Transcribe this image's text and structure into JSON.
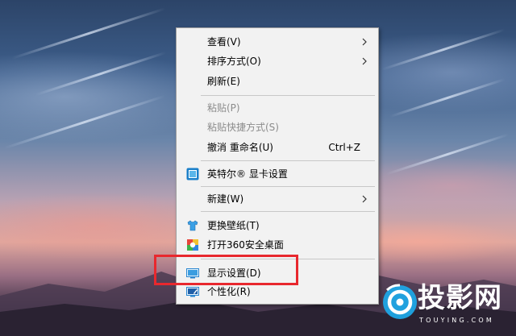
{
  "context_menu": {
    "items": [
      {
        "label": "查看(V)",
        "has_submenu": true,
        "enabled": true
      },
      {
        "label": "排序方式(O)",
        "has_submenu": true,
        "enabled": true
      },
      {
        "label": "刷新(E)",
        "enabled": true
      },
      {
        "label": "粘贴(P)",
        "enabled": false
      },
      {
        "label": "粘贴快捷方式(S)",
        "enabled": false
      },
      {
        "label": "撤消 重命名(U)",
        "shortcut": "Ctrl+Z",
        "enabled": true
      },
      {
        "label": "英特尔® 显卡设置",
        "icon": "intel-graphics-icon",
        "enabled": true
      },
      {
        "label": "新建(W)",
        "has_submenu": true,
        "enabled": true
      },
      {
        "label": "更换壁纸(T)",
        "icon": "wallpaper-shirt-icon",
        "enabled": true
      },
      {
        "label": "打开360安全桌面",
        "icon": "360-desktop-icon",
        "enabled": true
      },
      {
        "label": "显示设置(D)",
        "icon": "display-settings-icon",
        "enabled": true,
        "highlighted_by_annotation": true
      },
      {
        "label": "个性化(R)",
        "icon": "personalize-icon",
        "enabled": true
      }
    ]
  },
  "annotation": {
    "color": "#e8282e"
  },
  "watermark": {
    "brand": "投影网",
    "sub": "TOUYING.COM"
  },
  "colors": {
    "menu_bg": "#f2f2f2",
    "disabled_text": "#8c8c8c",
    "brand_blue": "#1ea6e6"
  }
}
